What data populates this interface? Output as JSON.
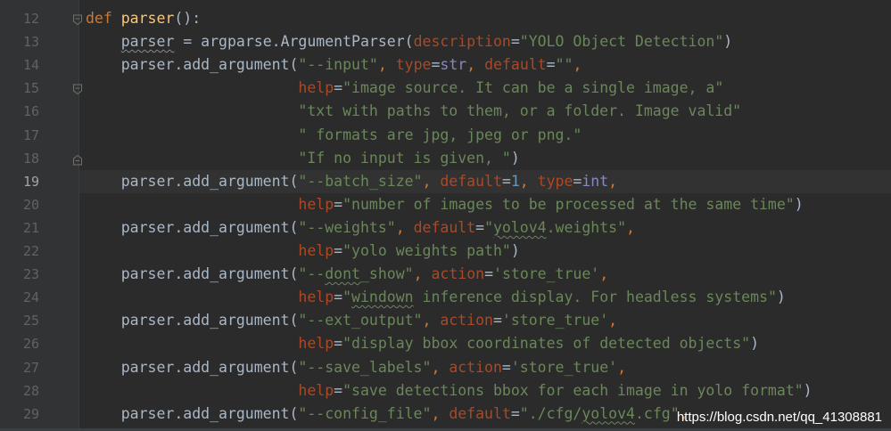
{
  "lines": [
    {
      "num": "12",
      "tokens": [
        {
          "c": "kw",
          "t": "def "
        },
        {
          "c": "fn",
          "t": "parser"
        },
        {
          "c": "plain",
          "t": "():"
        }
      ]
    },
    {
      "num": "13",
      "tokens": [
        {
          "c": "plain",
          "t": "    "
        },
        {
          "c": "typo-plain",
          "t": "parser"
        },
        {
          "c": "plain",
          "t": " = argparse.ArgumentParser("
        },
        {
          "c": "param",
          "t": "description"
        },
        {
          "c": "plain",
          "t": "="
        },
        {
          "c": "str",
          "t": "\"YOLO Object Detection\""
        },
        {
          "c": "plain",
          "t": ")"
        }
      ]
    },
    {
      "num": "14",
      "tokens": [
        {
          "c": "plain",
          "t": "    parser.add_argument("
        },
        {
          "c": "str",
          "t": "\"--input\""
        },
        {
          "c": "kw",
          "t": ", "
        },
        {
          "c": "param",
          "t": "type"
        },
        {
          "c": "plain",
          "t": "="
        },
        {
          "c": "builtin",
          "t": "str"
        },
        {
          "c": "kw",
          "t": ", "
        },
        {
          "c": "param",
          "t": "default"
        },
        {
          "c": "plain",
          "t": "="
        },
        {
          "c": "str",
          "t": "\"\""
        },
        {
          "c": "kw",
          "t": ","
        }
      ]
    },
    {
      "num": "15",
      "tokens": [
        {
          "c": "plain",
          "t": "                        "
        },
        {
          "c": "param",
          "t": "help"
        },
        {
          "c": "plain",
          "t": "="
        },
        {
          "c": "str",
          "t": "\"image source. It can be a single image, a\""
        }
      ]
    },
    {
      "num": "16",
      "tokens": [
        {
          "c": "plain",
          "t": "                        "
        },
        {
          "c": "str",
          "t": "\"txt with paths to them, or a folder. Image valid\""
        }
      ]
    },
    {
      "num": "17",
      "tokens": [
        {
          "c": "plain",
          "t": "                        "
        },
        {
          "c": "str",
          "t": "\" formats are jpg, jpeg or png.\""
        }
      ]
    },
    {
      "num": "18",
      "tokens": [
        {
          "c": "plain",
          "t": "                        "
        },
        {
          "c": "str",
          "t": "\"If no input is given, \""
        },
        {
          "c": "plain",
          "t": ")"
        }
      ]
    },
    {
      "num": "19",
      "tokens": [
        {
          "c": "plain",
          "t": "    parser.add_argument("
        },
        {
          "c": "str",
          "t": "\"--batch_size\""
        },
        {
          "c": "kw",
          "t": ", "
        },
        {
          "c": "param",
          "t": "default"
        },
        {
          "c": "plain",
          "t": "="
        },
        {
          "c": "num",
          "t": "1"
        },
        {
          "c": "kw",
          "t": ", "
        },
        {
          "c": "param",
          "t": "type"
        },
        {
          "c": "plain",
          "t": "="
        },
        {
          "c": "builtin",
          "t": "int"
        },
        {
          "c": "kw",
          "t": ","
        }
      ]
    },
    {
      "num": "20",
      "tokens": [
        {
          "c": "plain",
          "t": "                        "
        },
        {
          "c": "param",
          "t": "help"
        },
        {
          "c": "plain",
          "t": "="
        },
        {
          "c": "str",
          "t": "\"number of images to be processed at the same time\""
        },
        {
          "c": "plain",
          "t": ")"
        }
      ]
    },
    {
      "num": "21",
      "tokens": [
        {
          "c": "plain",
          "t": "    parser.add_argument("
        },
        {
          "c": "str",
          "t": "\"--weights\""
        },
        {
          "c": "kw",
          "t": ", "
        },
        {
          "c": "param",
          "t": "default"
        },
        {
          "c": "plain",
          "t": "="
        },
        {
          "c": "str",
          "t": "\""
        },
        {
          "c": "str typo",
          "t": "yolov4"
        },
        {
          "c": "str",
          "t": ".weights\""
        },
        {
          "c": "kw",
          "t": ","
        }
      ]
    },
    {
      "num": "22",
      "tokens": [
        {
          "c": "plain",
          "t": "                        "
        },
        {
          "c": "param",
          "t": "help"
        },
        {
          "c": "plain",
          "t": "="
        },
        {
          "c": "str",
          "t": "\"yolo weights path\""
        },
        {
          "c": "plain",
          "t": ")"
        }
      ]
    },
    {
      "num": "23",
      "tokens": [
        {
          "c": "plain",
          "t": "    parser.add_argument("
        },
        {
          "c": "str",
          "t": "\"--"
        },
        {
          "c": "str typo",
          "t": "dont"
        },
        {
          "c": "str",
          "t": "_show\""
        },
        {
          "c": "kw",
          "t": ", "
        },
        {
          "c": "param",
          "t": "action"
        },
        {
          "c": "plain",
          "t": "="
        },
        {
          "c": "str",
          "t": "'store_true'"
        },
        {
          "c": "kw",
          "t": ","
        }
      ]
    },
    {
      "num": "24",
      "tokens": [
        {
          "c": "plain",
          "t": "                        "
        },
        {
          "c": "param",
          "t": "help"
        },
        {
          "c": "plain",
          "t": "="
        },
        {
          "c": "str",
          "t": "\""
        },
        {
          "c": "str typo",
          "t": "windown"
        },
        {
          "c": "str",
          "t": " inference display. For headless systems\""
        },
        {
          "c": "plain",
          "t": ")"
        }
      ]
    },
    {
      "num": "25",
      "tokens": [
        {
          "c": "plain",
          "t": "    parser.add_argument("
        },
        {
          "c": "str",
          "t": "\"--ext_output\""
        },
        {
          "c": "kw",
          "t": ", "
        },
        {
          "c": "param",
          "t": "action"
        },
        {
          "c": "plain",
          "t": "="
        },
        {
          "c": "str",
          "t": "'store_true'"
        },
        {
          "c": "kw",
          "t": ","
        }
      ]
    },
    {
      "num": "26",
      "tokens": [
        {
          "c": "plain",
          "t": "                        "
        },
        {
          "c": "param",
          "t": "help"
        },
        {
          "c": "plain",
          "t": "="
        },
        {
          "c": "str",
          "t": "\"display bbox coordinates of detected objects\""
        },
        {
          "c": "plain",
          "t": ")"
        }
      ]
    },
    {
      "num": "27",
      "tokens": [
        {
          "c": "plain",
          "t": "    parser.add_argument("
        },
        {
          "c": "str",
          "t": "\"--save_labels\""
        },
        {
          "c": "kw",
          "t": ", "
        },
        {
          "c": "param",
          "t": "action"
        },
        {
          "c": "plain",
          "t": "="
        },
        {
          "c": "str",
          "t": "'store_true'"
        },
        {
          "c": "kw",
          "t": ","
        }
      ]
    },
    {
      "num": "28",
      "tokens": [
        {
          "c": "plain",
          "t": "                        "
        },
        {
          "c": "param",
          "t": "help"
        },
        {
          "c": "plain",
          "t": "="
        },
        {
          "c": "str",
          "t": "\"save detections bbox for each image in yolo format\""
        },
        {
          "c": "plain",
          "t": ")"
        }
      ]
    },
    {
      "num": "29",
      "tokens": [
        {
          "c": "plain",
          "t": "    parser.add_argument("
        },
        {
          "c": "str",
          "t": "\"--config_file\""
        },
        {
          "c": "kw",
          "t": ", "
        },
        {
          "c": "param",
          "t": "default"
        },
        {
          "c": "plain",
          "t": "="
        },
        {
          "c": "str",
          "t": "\"./cfg/"
        },
        {
          "c": "str typo",
          "t": "yolov4"
        },
        {
          "c": "str",
          "t": ".cfg\""
        },
        {
          "c": "kw",
          "t": ","
        }
      ]
    }
  ],
  "current_line": "19",
  "fold_lines": [
    "12",
    "15",
    "18"
  ],
  "watermark": "https://blog.csdn.net/qq_41308881",
  "colors": {
    "background": "#2b2b2b",
    "gutter": "#313335",
    "keyword": "#cc7832",
    "function": "#ffc66d",
    "string": "#6a8759",
    "number": "#6897bb",
    "parameter": "#aa4926",
    "builtin": "#8888c6",
    "text": "#a9b7c6"
  }
}
